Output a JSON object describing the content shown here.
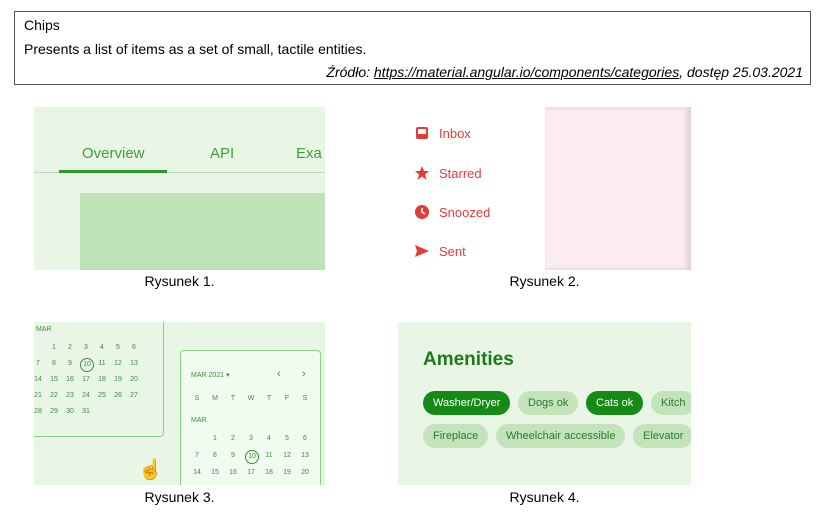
{
  "header": {
    "title": "Chips",
    "description": "Presents a list of items as a set of small, tactile entities.",
    "source_prefix": "Źródło: ",
    "source_url": "https://material.angular.io/components/categories",
    "source_suffix": ", dostęp 25.03.2021"
  },
  "fig1": {
    "tabs": [
      "Overview",
      "API",
      "Exa"
    ],
    "caption": "Rysunek 1.",
    "accent": "#2a9a2a"
  },
  "fig2": {
    "items": [
      {
        "label": "Inbox",
        "icon": "inbox-icon"
      },
      {
        "label": "Starred",
        "icon": "star-icon"
      },
      {
        "label": "Snoozed",
        "icon": "clock-icon"
      },
      {
        "label": "Sent",
        "icon": "send-icon"
      }
    ],
    "caption": "Rysunek 2.",
    "accent": "#e53a3a"
  },
  "fig3": {
    "left_month": "MAR",
    "left_rows": [
      [
        "",
        "1",
        "2",
        "3",
        "4",
        "5",
        "6"
      ],
      [
        "7",
        "8",
        "9",
        "10",
        "11",
        "12",
        "13"
      ],
      [
        "14",
        "15",
        "16",
        "17",
        "18",
        "19",
        "20"
      ],
      [
        "21",
        "22",
        "23",
        "24",
        "25",
        "26",
        "27"
      ],
      [
        "28",
        "29",
        "30",
        "31",
        "",
        "",
        ""
      ]
    ],
    "right_header": "MAR 2021 ▾",
    "weekdays": [
      "S",
      "M",
      "T",
      "W",
      "T",
      "F",
      "S"
    ],
    "right_month": "MAR",
    "right_rows": [
      [
        "",
        "1",
        "2",
        "3",
        "4",
        "5",
        "6"
      ],
      [
        "7",
        "8",
        "9",
        "10",
        "11",
        "12",
        "13"
      ],
      [
        "14",
        "15",
        "16",
        "17",
        "18",
        "19",
        "20"
      ]
    ],
    "caption": "Rysunek 3."
  },
  "fig4": {
    "title": "Amenities",
    "row1": [
      {
        "label": "Washer/Dryer",
        "selected": true
      },
      {
        "label": "Dogs ok",
        "selected": false
      },
      {
        "label": "Cats ok",
        "selected": true
      },
      {
        "label": "Kitch",
        "selected": false
      }
    ],
    "row2": [
      {
        "label": "Fireplace",
        "selected": false
      },
      {
        "label": "Wheelchair accessible",
        "selected": false
      },
      {
        "label": "Elevator",
        "selected": false
      }
    ],
    "caption": "Rysunek 4."
  }
}
